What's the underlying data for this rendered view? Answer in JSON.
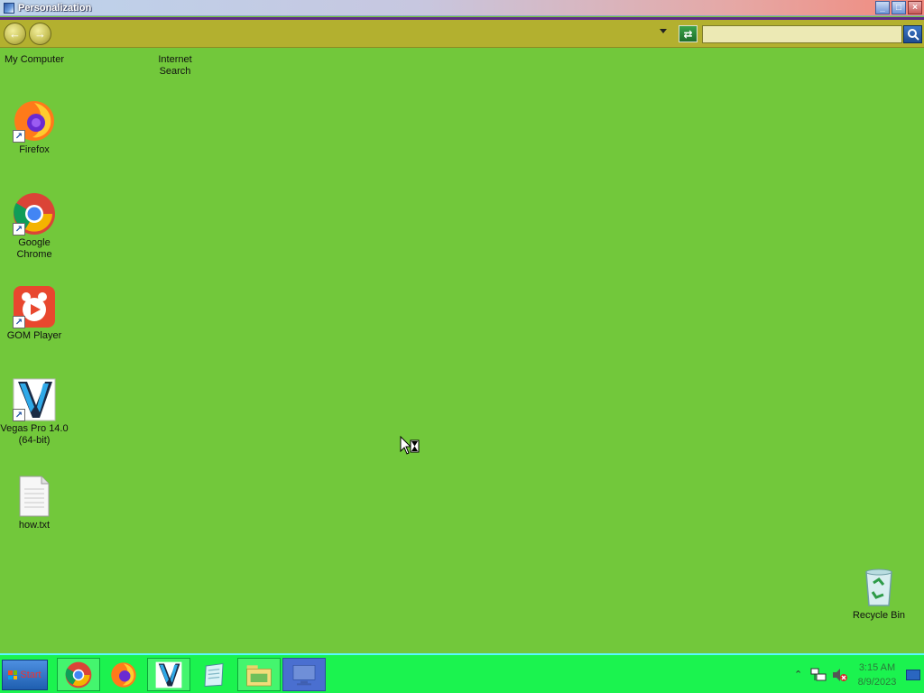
{
  "window": {
    "title": "Personalization",
    "controls": {
      "minimize": "_",
      "maximize": "□",
      "close": "×"
    }
  },
  "toolbar": {
    "back_icon": "back-arrow-icon",
    "forward_icon": "forward-arrow-icon",
    "address_value": "",
    "search_placeholder": "",
    "refresh_icon": "refresh-icon",
    "search_icon": "magnifier-icon",
    "accent_color": "#b3b02f"
  },
  "desktop": {
    "background_color": "#72c83b",
    "icons": [
      {
        "label": "My Computer"
      },
      {
        "label": "Internet Search"
      },
      {
        "label": "Firefox"
      },
      {
        "label": "Google Chrome"
      },
      {
        "label": "GOM Player"
      },
      {
        "label": "Vegas Pro 14.0 (64-bit)"
      },
      {
        "label": "how.txt"
      },
      {
        "label": "Recycle Bin"
      }
    ]
  },
  "taskbar": {
    "color": "#1bf34f",
    "start_label": "Start",
    "apps": [
      "chrome-icon",
      "firefox-icon",
      "vegas-pro-icon",
      "notepad-icon",
      "file-explorer-icon",
      "remote-desktop-icon"
    ],
    "tray": {
      "time": "3:15 AM",
      "date": "8/9/2023"
    }
  }
}
